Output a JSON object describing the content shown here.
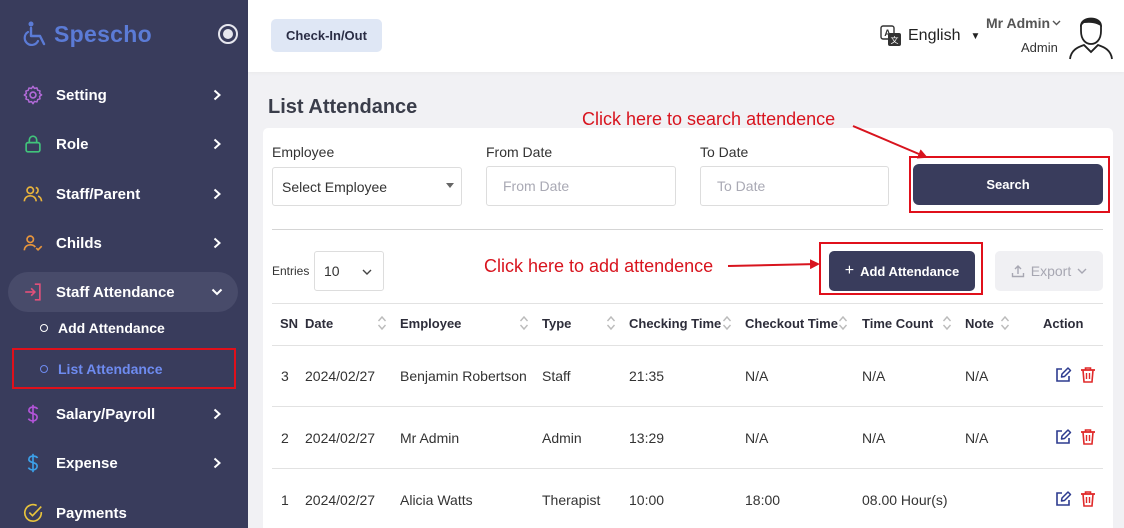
{
  "app": {
    "logo_text": "Spescho"
  },
  "sidebar": {
    "items": [
      {
        "label": "Setting",
        "icon": "gear-icon",
        "color": "#b26ad8"
      },
      {
        "label": "Role",
        "icon": "lock-icon",
        "color": "#41c47b"
      },
      {
        "label": "Staff/Parent",
        "icon": "users-icon",
        "color": "#e9b43c"
      },
      {
        "label": "Childs",
        "icon": "user-check-icon",
        "color": "#e9963c"
      },
      {
        "label": "Staff Attendance",
        "icon": "login-icon",
        "color": "#e0507a"
      },
      {
        "label": "Salary/Payroll",
        "icon": "dollar-icon",
        "color": "#b254d8"
      },
      {
        "label": "Expense",
        "icon": "dollar-icon",
        "color": "#3ca0e9"
      },
      {
        "label": "Payments",
        "icon": "check-circle-icon",
        "color": "#e9c43c"
      }
    ],
    "sub_items": [
      {
        "label": "Add Attendance"
      },
      {
        "label": "List Attendance"
      }
    ]
  },
  "topbar": {
    "checkin_label": "Check-In/Out",
    "language": "English",
    "user_name": "Mr Admin",
    "user_role": "Admin"
  },
  "page": {
    "title": "List Attendance"
  },
  "filters": {
    "employee_label": "Employee",
    "employee_value": "Select Employee",
    "from_label": "From Date",
    "from_placeholder": "From Date",
    "to_label": "To Date",
    "to_placeholder": "To Date",
    "search_label": "Search"
  },
  "toolbar": {
    "entries_label": "Entries",
    "entries_value": "10",
    "add_label": "Add Attendance",
    "export_label": "Export"
  },
  "annotations": {
    "search_hint": "Click here to search attendence",
    "add_hint": "Click here to add attendence"
  },
  "table": {
    "columns": [
      "SN",
      "Date",
      "Employee",
      "Type",
      "Checking Time",
      "Checkout Time",
      "Time Count",
      "Note",
      "Action"
    ],
    "rows": [
      {
        "sn": "3",
        "date": "2024/02/27",
        "employee": "Benjamin Robertson",
        "type": "Staff",
        "checkin": "21:35",
        "checkout": "N/A",
        "count": "N/A",
        "note": "N/A"
      },
      {
        "sn": "2",
        "date": "2024/02/27",
        "employee": "Mr Admin",
        "type": "Admin",
        "checkin": "13:29",
        "checkout": "N/A",
        "count": "N/A",
        "note": "N/A"
      },
      {
        "sn": "1",
        "date": "2024/02/27",
        "employee": "Alicia Watts",
        "type": "Therapist",
        "checkin": "10:00",
        "checkout": "18:00",
        "count": "08.00 Hour(s)",
        "note": ""
      }
    ]
  },
  "colors": {
    "sidebar_bg": "#393c5c",
    "primary_button": "#393c5c",
    "annotation_red": "#d8141e",
    "active_sub_item": "#6e8bf0",
    "edit_icon": "#2d3b8f",
    "delete_icon": "#e02a2a"
  }
}
